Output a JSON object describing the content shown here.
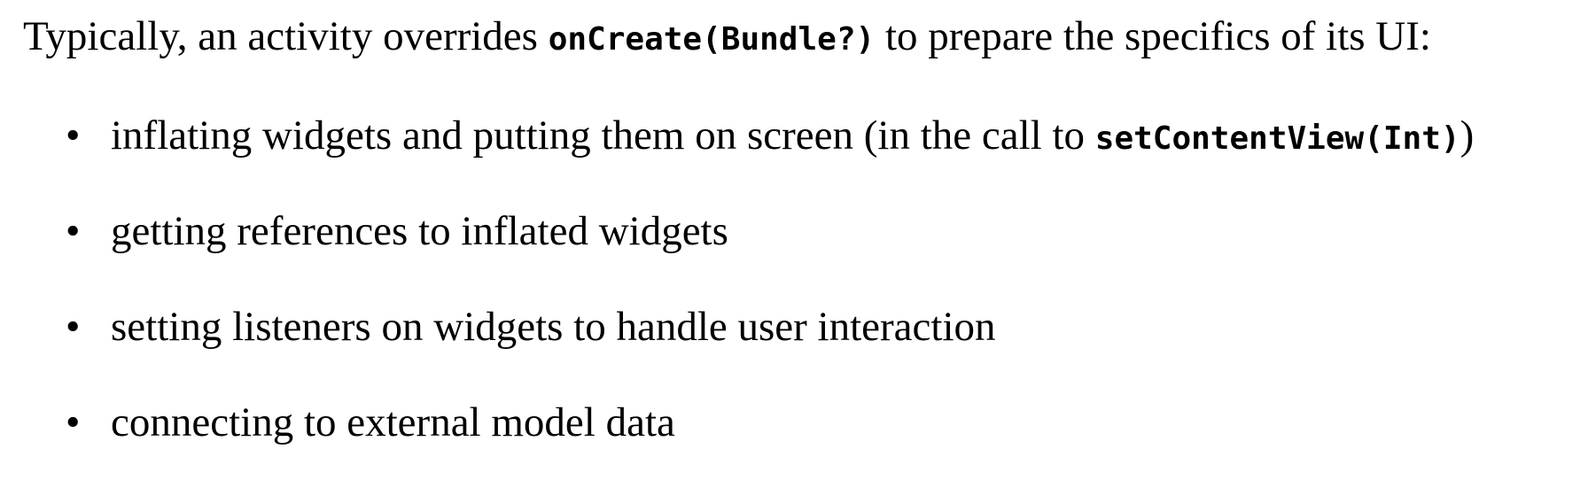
{
  "paragraph": {
    "text_before": "Typically, an activity overrides ",
    "code": "onCreate(Bundle?)",
    "text_after": " to prepare the specifics of its UI:"
  },
  "bullet_symbol": "•",
  "items": [
    {
      "text_before": "inflating widgets and putting them on screen (in the call to ",
      "code": "setContentView(Int)",
      "text_after": ")"
    },
    {
      "text": "getting references to inflated widgets"
    },
    {
      "text": "setting listeners on widgets to handle user interaction"
    },
    {
      "text": "connecting to external model data"
    }
  ]
}
